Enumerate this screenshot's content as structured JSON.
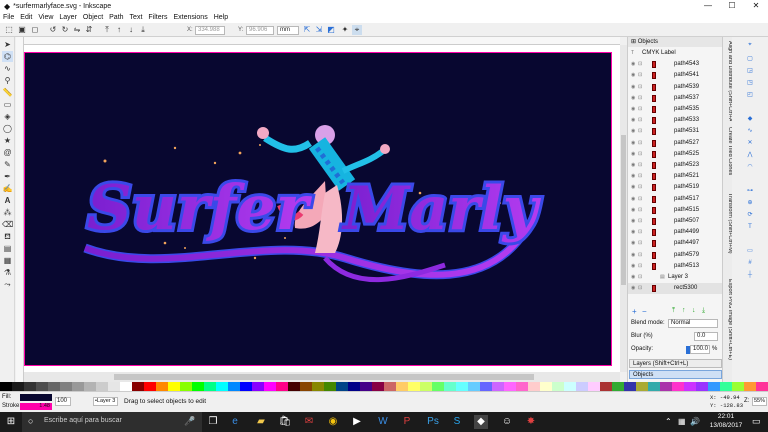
{
  "window": {
    "title": "*surfermarlyface.svg - Inkscape",
    "min": "—",
    "max": "☐",
    "close": "✕"
  },
  "menu": [
    "File",
    "Edit",
    "View",
    "Layer",
    "Object",
    "Path",
    "Text",
    "Filters",
    "Extensions",
    "Help"
  ],
  "toolbar": {
    "x_label": "X:",
    "x_value": "334.988",
    "y_label": "Y:",
    "y_value": "96.906",
    "unit": "mm"
  },
  "artwork": {
    "line1": "Surfer",
    "line2": "Marly"
  },
  "panel": {
    "title": "Objects",
    "items": [
      {
        "name": "CMYK Label",
        "type": "text"
      },
      {
        "name": "path4543"
      },
      {
        "name": "path4541"
      },
      {
        "name": "path4539"
      },
      {
        "name": "path4537"
      },
      {
        "name": "path4535"
      },
      {
        "name": "path4533"
      },
      {
        "name": "path4531"
      },
      {
        "name": "path4527"
      },
      {
        "name": "path4525"
      },
      {
        "name": "path4523"
      },
      {
        "name": "path4521"
      },
      {
        "name": "path4519"
      },
      {
        "name": "path4517"
      },
      {
        "name": "path4515"
      },
      {
        "name": "path4507"
      },
      {
        "name": "path4499"
      },
      {
        "name": "path4497"
      },
      {
        "name": "path4579"
      },
      {
        "name": "path4513"
      },
      {
        "name": "Layer 3",
        "type": "layer"
      },
      {
        "name": "rect5300"
      }
    ],
    "blend_label": "Blend mode:",
    "blend_value": "Normal",
    "blur_label": "Blur (%)",
    "blur_value": "0.0",
    "opacity_label": "Opacity:",
    "opacity_value": "100.0",
    "opacity_unit": "%",
    "tab_layers": "Layers (Shift+Ctrl+L)",
    "tab_objects": "Objects"
  },
  "side_tabs": [
    "Align and Distribute (Shift+Ctrl+A)",
    "Create Tiled Clones",
    "Transform (Shift+Ctrl+M)",
    "Export PNG Image (Shift+Ctrl+E)"
  ],
  "status": {
    "fill_label": "Fill:",
    "stroke_label": "Stroke:",
    "stroke_width": "1.48",
    "opacity": "100",
    "layer": "•Layer 3",
    "message": "Drag to select objects to edit",
    "x": "X: -49.94",
    "y": "Y: -128.83",
    "z_label": "Z:",
    "zoom": "55%"
  },
  "taskbar": {
    "search_placeholder": "Escribe aquí para buscar",
    "time": "22:01",
    "date": "13/08/2017"
  },
  "colors": {
    "page": "#080730",
    "accent": "#9b2bdf",
    "selection": "#2a6fd6"
  }
}
